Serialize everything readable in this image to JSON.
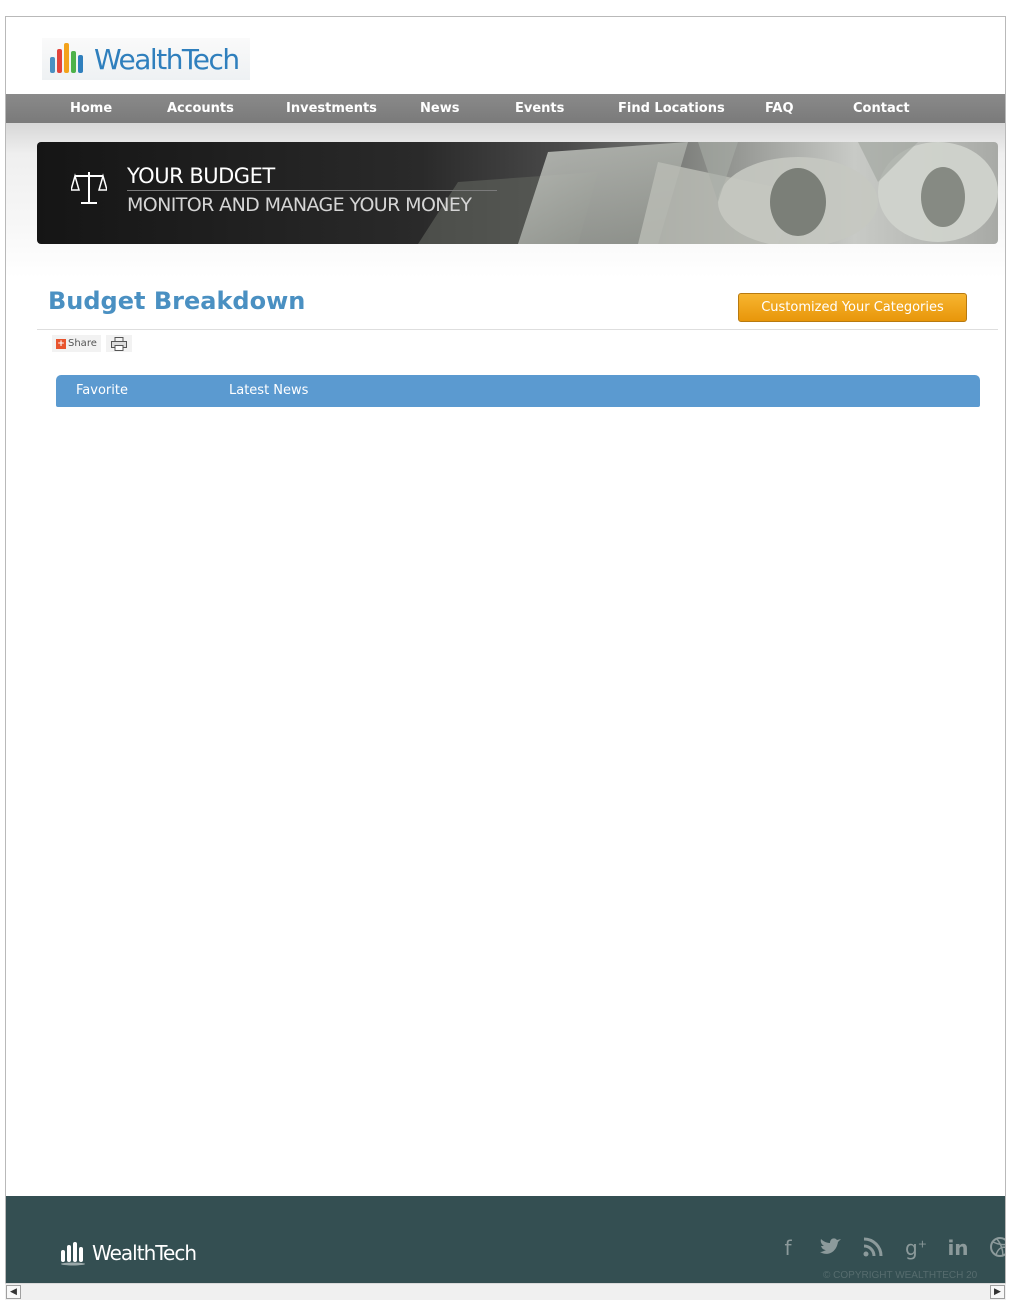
{
  "brand": {
    "name": "WealthTech"
  },
  "nav": {
    "items": [
      "Home",
      "Accounts",
      "Investments",
      "News",
      "Events",
      "Find Locations",
      "FAQ",
      "Contact"
    ]
  },
  "banner": {
    "title": "YOUR BUDGET",
    "subtitle": "MONITOR AND MANAGE YOUR MONEY",
    "icon": "scales-icon"
  },
  "page": {
    "title": "Budget Breakdown",
    "customize_button": "Customized Your Categories"
  },
  "toolbar": {
    "share_label": "Share",
    "share_icon": "plus-icon",
    "print_icon": "printer-icon"
  },
  "tabs": [
    {
      "label": "Favorite"
    },
    {
      "label": "Latest News"
    }
  ],
  "footer": {
    "brand": "WealthTech",
    "social": [
      "facebook-icon",
      "twitter-icon",
      "rss-icon",
      "google-plus-icon",
      "linkedin-icon",
      "dribbble-icon"
    ],
    "copyright": "© COPYRIGHT WEALTHTECH 20"
  },
  "colors": {
    "brand_blue": "#2f7fbd",
    "nav_gray": "#808080",
    "tab_blue": "#5b9ad0",
    "button_orange": "#f0a31a",
    "footer_teal": "#344f52"
  }
}
